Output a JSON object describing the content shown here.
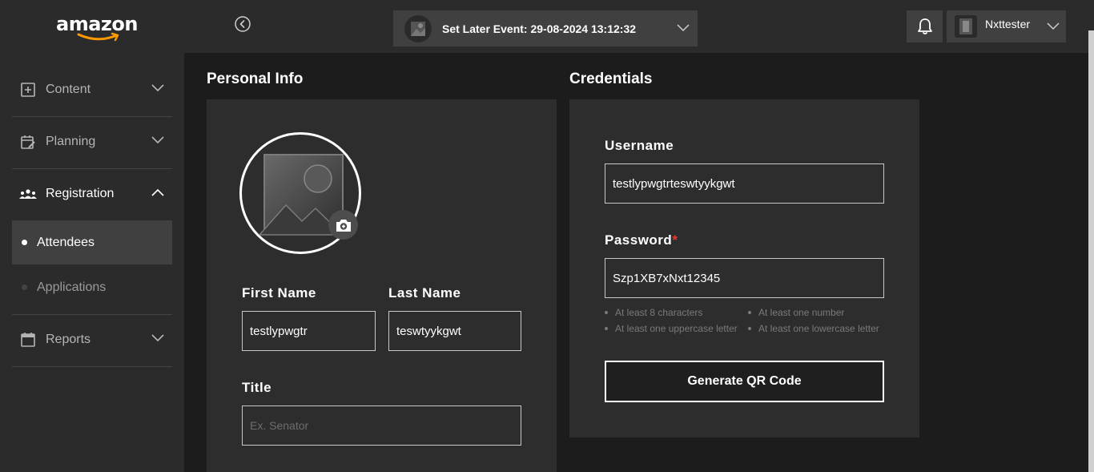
{
  "brand": {
    "logo_text": "amazon"
  },
  "header": {
    "event_label": "Set Later Event: 29-08-2024 13:12:32",
    "user_name": "Nxttester"
  },
  "sidebar": {
    "items": [
      {
        "label": "Content",
        "icon": "plus-square-icon"
      },
      {
        "label": "Planning",
        "icon": "calendar-edit-icon"
      },
      {
        "label": "Registration",
        "icon": "people-group-icon"
      },
      {
        "label": "Reports",
        "icon": "calendar-icon"
      }
    ],
    "registration_sub": [
      {
        "label": "Attendees",
        "active": true
      },
      {
        "label": "Applications",
        "active": false
      }
    ]
  },
  "personal_info": {
    "title": "Personal Info",
    "first_name_label": "First Name",
    "first_name_value": "testlypwgtr",
    "last_name_label": "Last Name",
    "last_name_value": "teswtyykgwt",
    "title_label": "Title",
    "title_placeholder": "Ex. Senator"
  },
  "credentials": {
    "title": "Credentials",
    "username_label": "Username",
    "username_value": "testlypwgtrteswtyykgwt",
    "password_label": "Password",
    "password_required": "*",
    "password_value": "Szp1XB7xNxt12345",
    "hints": [
      "At least 8 characters",
      "At least one number",
      "At least one uppercase letter",
      "At least one lowercase letter"
    ],
    "qr_button": "Generate QR Code"
  },
  "colors": {
    "background": "#1c1c1c",
    "panel": "#2b2b2b",
    "card": "#2d2d2d",
    "accent_required": "#e53935",
    "logo_smile": "#f90"
  }
}
